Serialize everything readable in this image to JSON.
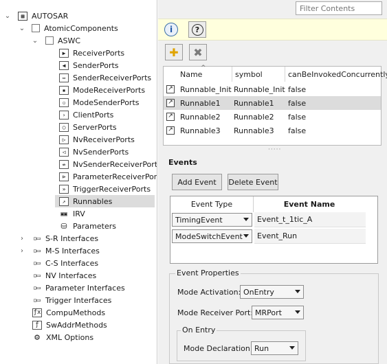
{
  "tree": {
    "root": "AUTOSAR",
    "atomic": "AtomicComponents",
    "aswc": "ASWC",
    "ports": [
      {
        "label": "ReceiverPorts",
        "icon": "receiver-port-icon",
        "glyph": "▶"
      },
      {
        "label": "SenderPorts",
        "icon": "sender-port-icon",
        "glyph": "◀"
      },
      {
        "label": "SenderReceiverPorts",
        "icon": "sender-receiver-port-icon",
        "glyph": "⇔"
      },
      {
        "label": "ModeReceiverPorts",
        "icon": "mode-receiver-port-icon",
        "glyph": "▪"
      },
      {
        "label": "ModeSenderPorts",
        "icon": "mode-sender-port-icon",
        "glyph": "▫"
      },
      {
        "label": "ClientPorts",
        "icon": "client-port-icon",
        "glyph": "›"
      },
      {
        "label": "ServerPorts",
        "icon": "server-port-icon",
        "glyph": "○"
      },
      {
        "label": "NvReceiverPorts",
        "icon": "nv-receiver-port-icon",
        "glyph": "▷"
      },
      {
        "label": "NvSenderPorts",
        "icon": "nv-sender-port-icon",
        "glyph": "◁"
      },
      {
        "label": "NvSenderReceiverPorts",
        "icon": "nv-sender-receiver-port-icon",
        "glyph": "⇎"
      },
      {
        "label": "ParameterReceiverPorts",
        "icon": "parameter-receiver-port-icon",
        "glyph": "⊳"
      },
      {
        "label": "TriggerReceiverPorts",
        "icon": "trigger-receiver-port-icon",
        "glyph": "»"
      }
    ],
    "runnables": "Runnables",
    "irv": "IRV",
    "parameters": "Parameters",
    "interfaces": [
      {
        "label": "S-R Interfaces",
        "expandable": true
      },
      {
        "label": "M-S Interfaces",
        "expandable": true
      },
      {
        "label": "C-S Interfaces",
        "expandable": false
      },
      {
        "label": "NV Interfaces",
        "expandable": false
      },
      {
        "label": "Parameter Interfaces",
        "expandable": false
      },
      {
        "label": "Trigger Interfaces",
        "expandable": false
      }
    ],
    "compu": "CompuMethods",
    "swaddr": "SwAddrMethods",
    "xml": "XML Options"
  },
  "filter": {
    "placeholder": "Filter Contents"
  },
  "infobar": {
    "info_glyph": "i",
    "help_glyph": "?"
  },
  "toolbar": {
    "add_glyph": "✚",
    "delete_glyph": "✖"
  },
  "runnables_table": {
    "columns": [
      "Name",
      "symbol",
      "canBeInvokedConcurrently"
    ],
    "rows": [
      {
        "name": "Runnable_Init",
        "symbol": "Runnable_Init",
        "concurrent": "false"
      },
      {
        "name": "Runnable1",
        "symbol": "Runnable1",
        "concurrent": "false"
      },
      {
        "name": "Runnable2",
        "symbol": "Runnable2",
        "concurrent": "false"
      },
      {
        "name": "Runnable3",
        "symbol": "Runnable3",
        "concurrent": "false"
      }
    ],
    "selected_row": 1,
    "sort_glyph": "^"
  },
  "events": {
    "title": "Events",
    "add_label": "Add Event",
    "delete_label": "Delete Event",
    "col_type": "Event Type",
    "col_name": "Event Name",
    "rows": [
      {
        "type": "TimingEvent",
        "name": "Event_t_1tic_A"
      },
      {
        "type": "ModeSwitchEvent",
        "name": "Event_Run"
      }
    ]
  },
  "properties": {
    "title": "Event Properties",
    "mode_activation_label": "Mode Activation:",
    "mode_activation_value": "OnEntry",
    "mode_receiver_label": "Mode Receiver Port:",
    "mode_receiver_value": "MRPort",
    "on_entry_title": "On Entry",
    "mode_decl_label": "Mode Declaration:",
    "mode_decl_value": "Run"
  },
  "colors": {
    "accent": "#e0a400",
    "selection": "#dcdcdc",
    "infobar": "#ffffdd"
  }
}
